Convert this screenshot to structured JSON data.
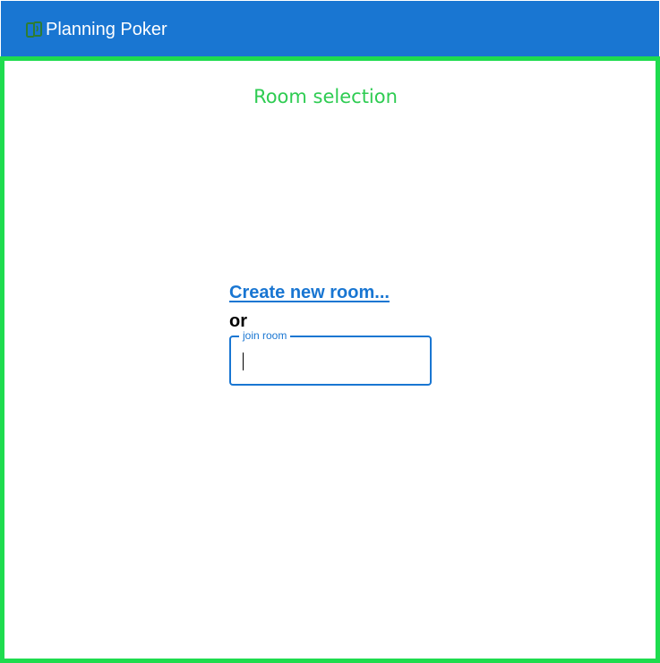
{
  "appbar": {
    "title": "Planning Poker",
    "icon": "cards-icon",
    "background_color": "#1976d2",
    "icon_color": "#2e7d32"
  },
  "main": {
    "page_title": "Room selection",
    "page_title_color": "#2ecc52",
    "frame_color": "#1edc4e",
    "create_room_label": "Create new room...",
    "or_text": "or",
    "join_room": {
      "label": "join room",
      "value": ""
    }
  }
}
